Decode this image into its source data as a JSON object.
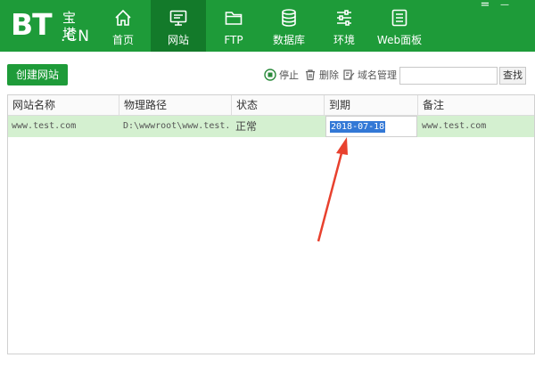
{
  "logo": {
    "main": "BT",
    "cn": ".CN",
    "bao": "宝塔"
  },
  "nav": [
    {
      "label": "首页",
      "icon": "home-icon"
    },
    {
      "label": "网站",
      "icon": "monitor-icon",
      "active": true
    },
    {
      "label": "FTP",
      "icon": "folder-icon"
    },
    {
      "label": "数据库",
      "icon": "database-icon"
    },
    {
      "label": "环境",
      "icon": "sliders-icon"
    },
    {
      "label": "Web面板",
      "icon": "panel-list-icon"
    }
  ],
  "window": {
    "menu": "=",
    "minimize": "—"
  },
  "toolbar": {
    "create_label": "创建网站",
    "stop_label": "停止",
    "delete_label": "删除",
    "domain_label": "域名管理",
    "search_placeholder": "",
    "search_label": "查找"
  },
  "table": {
    "columns": [
      "网站名称",
      "物理路径",
      "状态",
      "到期",
      "备注"
    ],
    "rows": [
      {
        "name": "www.test.com",
        "path": "D:\\wwwroot\\www.test...",
        "status": "正常",
        "expiry": "2018-07-18",
        "note": "www.test.com"
      }
    ]
  },
  "colors": {
    "brand": "#1e9b39",
    "brand_dark": "#137a2a",
    "row_selected": "#d4f0d0",
    "selection": "#3378d6",
    "arrow": "#e8412e"
  }
}
